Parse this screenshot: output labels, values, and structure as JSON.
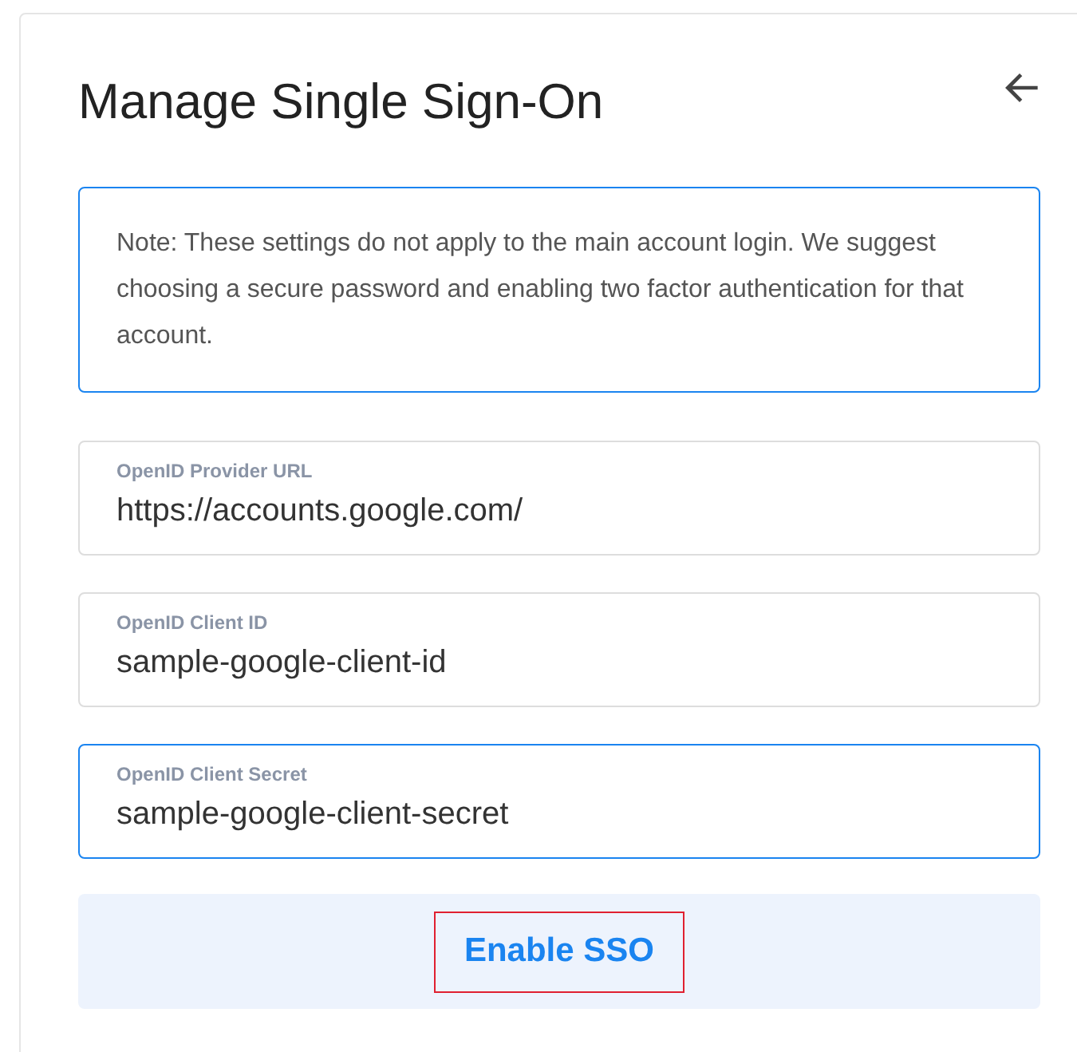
{
  "title": "Manage Single Sign-On",
  "note": "Note: These settings do not apply to the main account login. We suggest choosing a secure password and enabling two factor authentication for that account.",
  "fields": [
    {
      "label": "OpenID Provider URL",
      "value": "https://accounts.google.com/",
      "focused": false
    },
    {
      "label": "OpenID Client ID",
      "value": "sample-google-client-id",
      "focused": false
    },
    {
      "label": "OpenID Client Secret",
      "value": "sample-google-client-secret",
      "focused": true
    }
  ],
  "submit": {
    "label": "Enable SSO",
    "highlighted": true
  }
}
